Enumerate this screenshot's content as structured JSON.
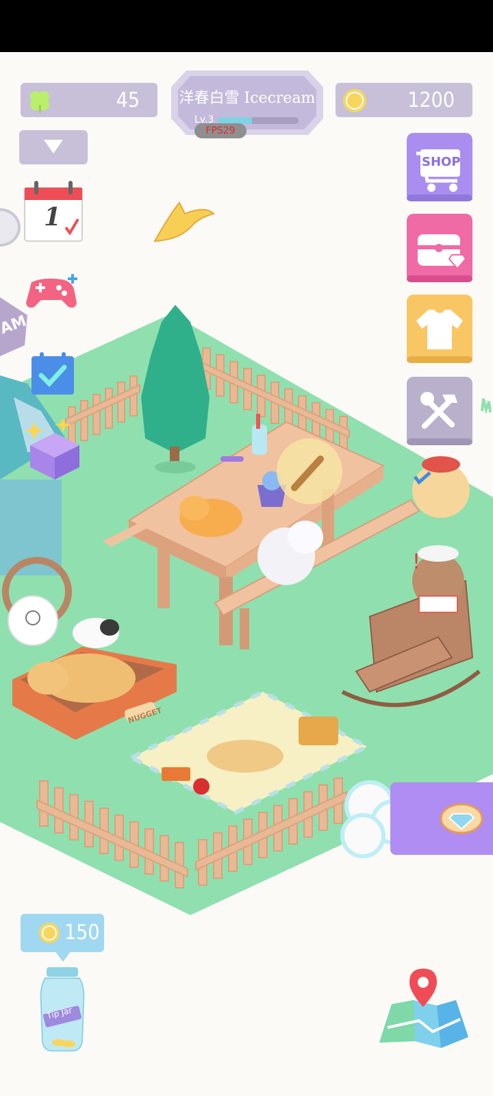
{
  "hud": {
    "clovers": "45",
    "coins": "1200",
    "player_name": "洋春白雪 Icecream",
    "level_label": "Lv.3",
    "level_progress": 0.42,
    "fps_label": "FPS29"
  },
  "calendar": {
    "day": "1"
  },
  "tip_jar": {
    "coins": "150",
    "jar_label": "Tip Jar"
  },
  "side_menu": {
    "shop_label": "SHOP",
    "items": [
      "shop-button",
      "treasure-chest-button",
      "wardrobe-button",
      "tools-button"
    ]
  },
  "scene": {
    "bed_label": "NUGGET",
    "sign_fragment": "AM"
  },
  "colors": {
    "grass": "#8fe0ae",
    "hud_panel": "#c7c0d8",
    "shop": "#a98ef0",
    "chest": "#f06aa6",
    "wardrobe": "#f8c763",
    "tools": "#b9b0cc"
  },
  "icons": [
    "clover-icon",
    "coin-icon",
    "chevron-down-icon",
    "calendar-icon",
    "gamepad-icon",
    "checklist-icon",
    "gift-box-icon",
    "cart-icon",
    "chest-icon",
    "tshirt-icon",
    "tools-icon",
    "map-icon",
    "diamond-icon",
    "comb-icon",
    "banana-peel-icon"
  ]
}
